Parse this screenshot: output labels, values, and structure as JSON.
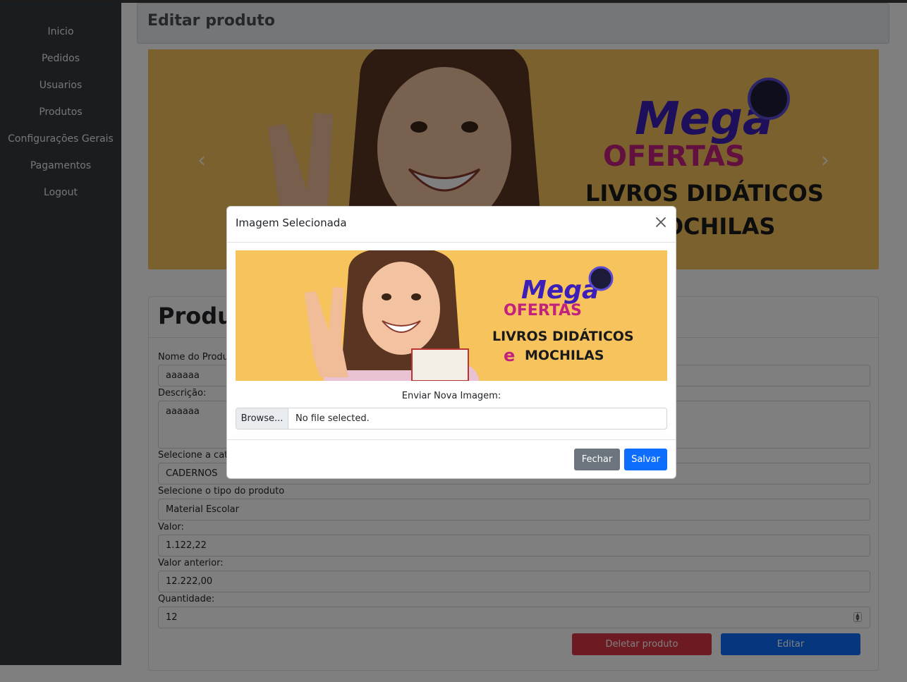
{
  "sidebar": {
    "items": [
      {
        "label": "Inicio"
      },
      {
        "label": "Pedidos"
      },
      {
        "label": "Usuarios"
      },
      {
        "label": "Produtos"
      },
      {
        "label": "Configurações Gerais"
      },
      {
        "label": "Pagamentos"
      },
      {
        "label": "Logout"
      }
    ]
  },
  "page": {
    "title": "Editar produto"
  },
  "banner": {
    "brand_top": "Mega",
    "brand_bottom": "OFERTAS",
    "line1": "LIVROS DIDÁTICOS",
    "line2_prefix": "e",
    "line2": "MOCHILAS",
    "prev_icon": "‹",
    "next_icon": "›"
  },
  "card": {
    "title": "Produto",
    "fields": {
      "name": {
        "label": "Nome do Produto:",
        "value": "aaaaaa"
      },
      "description": {
        "label": "Descrição:",
        "value": "aaaaaa"
      },
      "category": {
        "label": "Selecione a categoria",
        "value": "CADERNOS"
      },
      "type": {
        "label": "Selecione o tipo do produto",
        "value": "Material Escolar"
      },
      "price": {
        "label": "Valor:",
        "value": "1.122,22"
      },
      "previous_price": {
        "label": "Valor anterior:",
        "value": "12.222,00"
      },
      "quantity": {
        "label": "Quantidade:",
        "value": "12"
      }
    },
    "delete_label": "Deletar produto",
    "edit_label": "Editar"
  },
  "modal": {
    "title": "Imagem Selecionada",
    "upload_label": "Enviar Nova Imagem:",
    "browse_label": "Browse...",
    "file_status": "No file selected.",
    "close_label": "Fechar",
    "save_label": "Salvar"
  },
  "colors": {
    "sidebar_bg": "#343a40",
    "banner_bg": "#f6c35d",
    "primary": "#0d6efd",
    "danger": "#dc3545",
    "secondary": "#6c757d",
    "brand_purple": "#3b1fb8",
    "brand_pink": "#c2217e"
  }
}
